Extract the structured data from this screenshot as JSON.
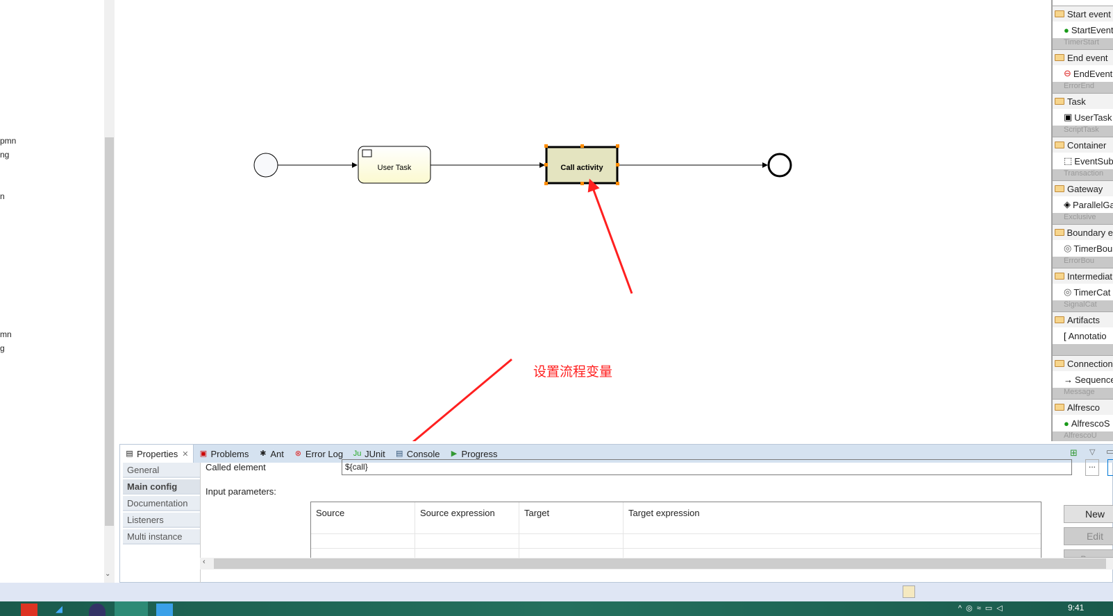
{
  "explorer": {
    "fragments": [
      "pmn",
      "ng",
      "n",
      "mn",
      "g"
    ]
  },
  "diagram": {
    "user_task_label": "User Task",
    "call_activity_label": "Call activity",
    "annotation": "设置流程变量",
    "annotation_color": "#ff2020",
    "selection_handle_color": "#ff8c00"
  },
  "palette": {
    "groups": [
      {
        "label": "Start event",
        "item": "StartEvent",
        "more": "TimerStart"
      },
      {
        "label": "End event",
        "item": "EndEvent",
        "more": "ErrorEnd"
      },
      {
        "label": "Task",
        "item": "UserTask",
        "more": "ScriptTask"
      },
      {
        "label": "Container",
        "item": "EventSub",
        "more": "Transaction"
      },
      {
        "label": "Gateway",
        "item": "ParallelGa",
        "more": "Exclusive"
      },
      {
        "label": "Boundary e",
        "item": "TimerBou",
        "more": "ErrorBou"
      },
      {
        "label": "Intermediat",
        "item": "TimerCat",
        "more": "SignalCat"
      },
      {
        "label": "Artifacts",
        "item": "Annotatio",
        "more": ""
      },
      {
        "label": "Connection",
        "item": "Sequence",
        "more": "Message"
      },
      {
        "label": "Alfresco",
        "item": "AlfrescoS",
        "more": "AlfrescoU"
      }
    ]
  },
  "views": {
    "tabs": [
      "Properties",
      "Problems",
      "Ant",
      "Error Log",
      "JUnit",
      "Console",
      "Progress"
    ]
  },
  "properties": {
    "sections": [
      "General",
      "Main config",
      "Documentation",
      "Listeners",
      "Multi instance"
    ],
    "called_element_label": "Called element",
    "called_element_value": "${call}",
    "browse_label": "...",
    "input_params_label": "Input parameters:",
    "columns": [
      "Source",
      "Source expression",
      "Target",
      "Target expression"
    ],
    "buttons": {
      "new": "New",
      "edit": "Edit",
      "remove": "Remove"
    }
  },
  "taskbar": {
    "clock": "9:41"
  }
}
